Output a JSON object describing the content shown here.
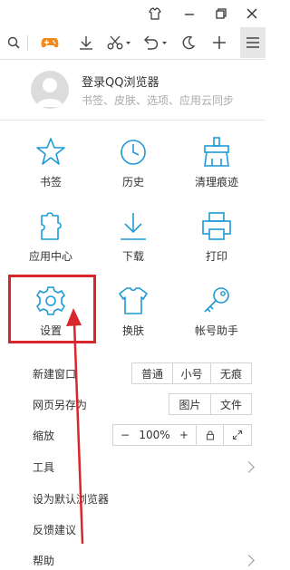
{
  "toolbar": {
    "icons": [
      "search-icon",
      "game-icon",
      "download-icon",
      "cut-icon",
      "undo-icon",
      "night-mode-icon",
      "new-tab-icon",
      "menu-icon"
    ]
  },
  "login": {
    "title": "登录QQ浏览器",
    "subtitle": "书签、皮肤、选项、应用云同步"
  },
  "grid": {
    "bookmarks": "书签",
    "history": "历史",
    "clear_traces": "清理痕迹",
    "app_center": "应用中心",
    "downloads": "下载",
    "print": "打印",
    "settings": "设置",
    "skins": "换肤",
    "account_assistant": "帐号助手"
  },
  "menu": {
    "new_window": "新建窗口",
    "new_window_options": [
      "普通",
      "小号",
      "无痕"
    ],
    "save_page_as": "网页另存为",
    "save_options": [
      "图片",
      "文件"
    ],
    "zoom": "缩放",
    "zoom_minus": "−",
    "zoom_value": "100%",
    "zoom_plus": "+",
    "tools": "工具",
    "set_default": "设为默认浏览器",
    "feedback": "反馈建议",
    "help": "帮助"
  },
  "colors": {
    "icon_blue": "#1f9ad6",
    "game_orange": "#f08a1c",
    "annotation_red": "#d9262d"
  }
}
